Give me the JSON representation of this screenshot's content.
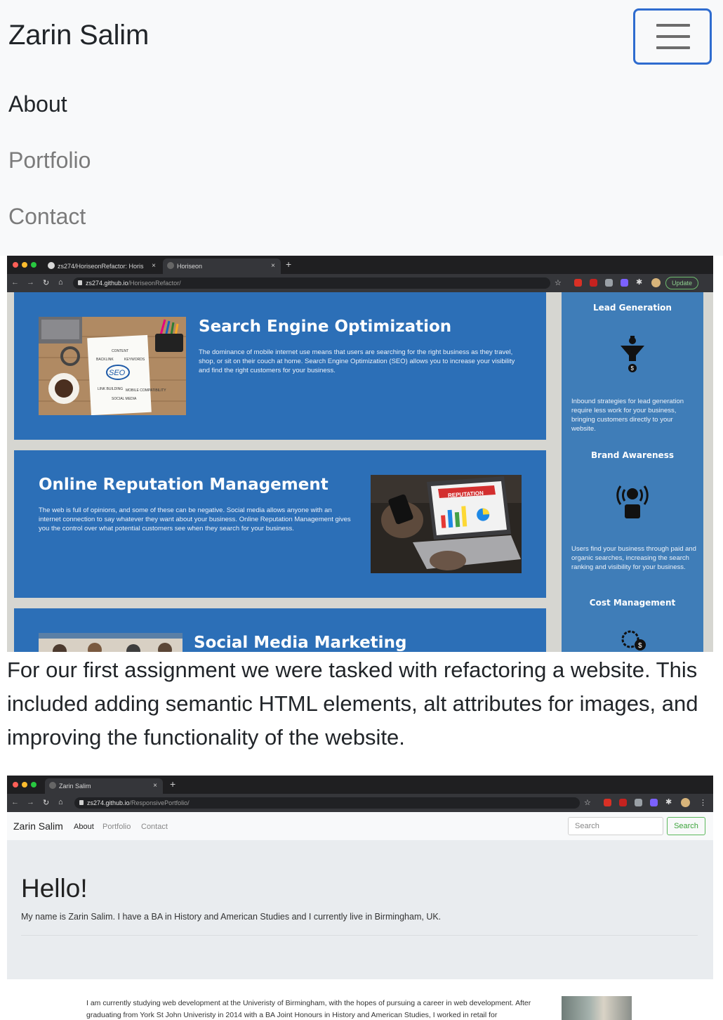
{
  "navbar": {
    "brand": "Zarin Salim",
    "toggler_icon": "hamburger-icon",
    "links": [
      "About",
      "Portfolio",
      "Contact"
    ]
  },
  "project1": {
    "browser": {
      "tabs": [
        "zs274/HoriseonRefactor: Horis",
        "Horiseon"
      ],
      "url_host": "zs274.github.io",
      "url_path": "/HoriseonRefactor/",
      "update_label": "Update"
    },
    "cards": [
      {
        "title": "Search Engine Optimization",
        "text": "The dominance of mobile internet use means that users are searching for the right business as they travel, shop, or sit on their couch at home. Search Engine Optimization (SEO) allows you to increase your visibility and find the right customers for your business."
      },
      {
        "title": "Online Reputation Management",
        "text": "The web is full of opinions, and some of these can be negative. Social media allows anyone with an internet connection to say whatever they want about your business. Online Reputation Management gives you the control over what potential customers see when they search for your business."
      },
      {
        "title": "Social Media Marketing",
        "text": ""
      }
    ],
    "sidebar": [
      {
        "title": "Lead Generation",
        "text": "Inbound strategies for lead generation require less work for your business, bringing customers directly to your website."
      },
      {
        "title": "Brand Awareness",
        "text": "Users find your business through paid and organic searches, increasing the search ranking and visibility for your business."
      },
      {
        "title": "Cost Management",
        "text": ""
      }
    ],
    "seo_image_words": [
      "SEO",
      "CONTENT",
      "BACKLINK",
      "KEYWORDS",
      "LINK BUILDING",
      "SOCIAL MEDIA",
      "MOBILE COMPATIBILITY"
    ],
    "reputation_screen_label": "REPUTATION",
    "caption": "For our first assignment we were tasked with refactoring a website. This included adding semantic HTML elements, alt attributes for images, and improving the functionality of the website."
  },
  "project2": {
    "browser": {
      "tab": "Zarin Salim",
      "url_host": "zs274.github.io",
      "url_path": "/ResponsivePortfolio/"
    },
    "nav": {
      "brand": "Zarin Salim",
      "links": [
        "About",
        "Portfolio",
        "Contact"
      ],
      "search_placeholder": "Search",
      "search_button": "Search"
    },
    "jumbotron": {
      "heading": "Hello!",
      "lead": "My name is Zarin Salim. I have a BA in History and American Studies and I currently live in Birmingham, UK."
    },
    "bio": "I am currently studying web development at the Univeristy of Birmingham, with the hopes of pursuing a career in web development. After graduating from York St John Univeristy in 2014 with a BA Joint Honours in History and American Studies, I worked in retail for"
  },
  "colors": {
    "navbar_bg": "#f8f9fa",
    "toggler_border": "#2f6ccf",
    "horiseon_blue": "#2c6fb7",
    "horiseon_side": "#3f7db8",
    "success_green": "#5cb85c"
  }
}
